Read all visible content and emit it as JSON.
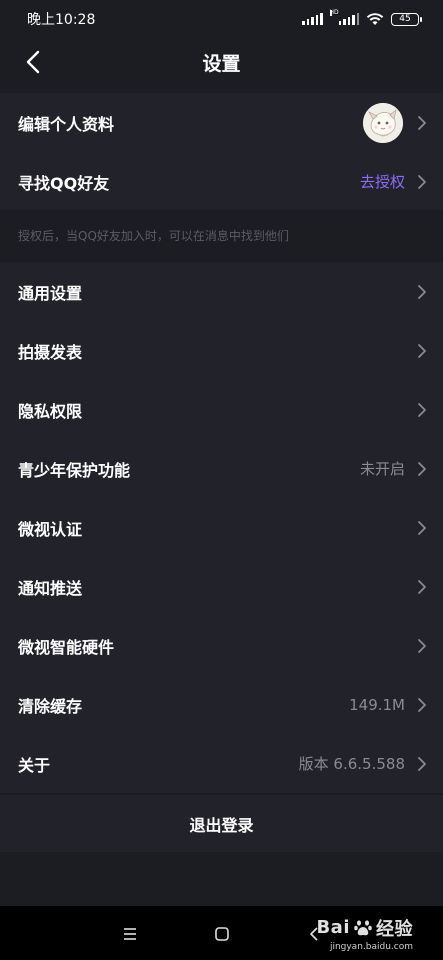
{
  "status_bar": {
    "time": "晚上10:28",
    "battery": "45",
    "hd_label": "HD"
  },
  "header": {
    "title": "设置"
  },
  "profile_rows": [
    {
      "label": "编辑个人资料",
      "value": ""
    },
    {
      "label": "寻找QQ好友",
      "value": "去授权"
    }
  ],
  "hint": "授权后，当QQ好友加入时，可以在消息中找到他们",
  "settings_rows": [
    {
      "label": "通用设置",
      "value": ""
    },
    {
      "label": "拍摄发表",
      "value": ""
    },
    {
      "label": "隐私权限",
      "value": ""
    },
    {
      "label": "青少年保护功能",
      "value": "未开启"
    },
    {
      "label": "微视认证",
      "value": ""
    },
    {
      "label": "通知推送",
      "value": ""
    },
    {
      "label": "微视智能硬件",
      "value": ""
    },
    {
      "label": "清除缓存",
      "value": "149.1M"
    },
    {
      "label": "关于",
      "value": "版本 6.6.5.588"
    }
  ],
  "logout_label": "退出登录",
  "watermark": {
    "brand_prefix": "Bai",
    "brand_suffix": "经验",
    "url": "jingyan.baidu.com"
  },
  "colors": {
    "background": "#1c1c23",
    "row_background": "#22222b",
    "accent": "#8c6cf5",
    "secondary_text": "#8a8a94"
  }
}
